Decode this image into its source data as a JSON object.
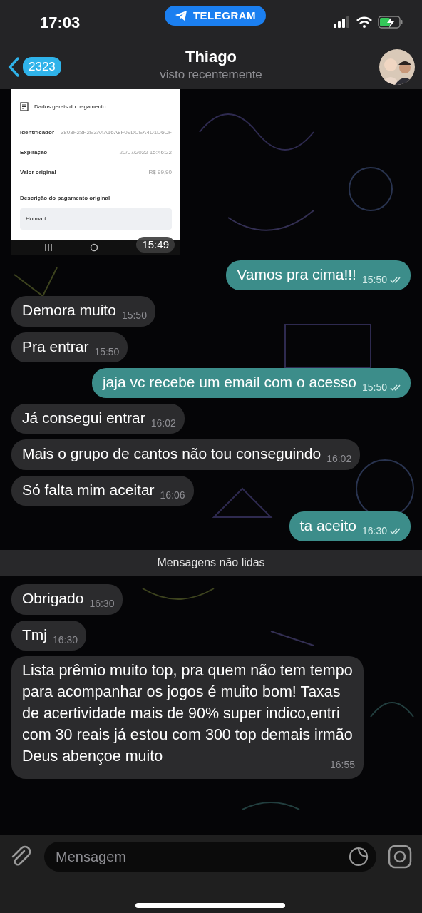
{
  "status_bar": {
    "time": "17:03",
    "app_pill": "TELEGRAM"
  },
  "header": {
    "back_count": "2323",
    "name": "Thiago",
    "status": "visto recentemente"
  },
  "messages": [
    {
      "kind": "image",
      "outgoing": false,
      "time": "15:49",
      "screenshot": {
        "title": "Dados gerais do pagamento",
        "rows": [
          {
            "label": "Identificador",
            "value": "3803F28F2E3A4A16A8F09DCEA4D1D6CF"
          },
          {
            "label": "Expiração",
            "value": "20/07/2022 15:46:22"
          },
          {
            "label": "Valor original",
            "value": "R$ 99,90"
          }
        ],
        "section": "Descrição do pagamento original",
        "description": "Hotmart"
      }
    },
    {
      "kind": "text",
      "outgoing": true,
      "text": "Vamos pra cima!!!",
      "time": "15:50",
      "read": true
    },
    {
      "kind": "text",
      "outgoing": false,
      "text": "Demora muito",
      "time": "15:50"
    },
    {
      "kind": "text",
      "outgoing": false,
      "text": "Pra entrar",
      "time": "15:50"
    },
    {
      "kind": "text",
      "outgoing": true,
      "text": "jaja vc recebe um email com o acesso",
      "time": "15:50",
      "read": true
    },
    {
      "kind": "text",
      "outgoing": false,
      "text": "Já consegui entrar",
      "time": "16:02"
    },
    {
      "kind": "text",
      "outgoing": false,
      "text": "Mais o grupo de cantos não tou conseguindo",
      "time": "16:02"
    },
    {
      "kind": "text",
      "outgoing": false,
      "text": "Só falta mim aceitar",
      "time": "16:06"
    },
    {
      "kind": "text",
      "outgoing": true,
      "text": "ta aceito",
      "time": "16:30",
      "read": true
    },
    {
      "kind": "divider",
      "text": "Mensagens não lidas"
    },
    {
      "kind": "text",
      "outgoing": false,
      "text": "Obrigado",
      "time": "16:30"
    },
    {
      "kind": "text",
      "outgoing": false,
      "text": "Tmj",
      "time": "16:30"
    },
    {
      "kind": "text",
      "outgoing": false,
      "text": "Lista prêmio muito top, pra quem não tem tempo para acompanhar os jogos é muito bom!  Taxas de acertividade mais de 90% super indico,entri com 30 reais já estou com 300 top demais irmão Deus abençoe muito",
      "time": "16:55"
    }
  ],
  "composer": {
    "placeholder": "Mensagem"
  }
}
